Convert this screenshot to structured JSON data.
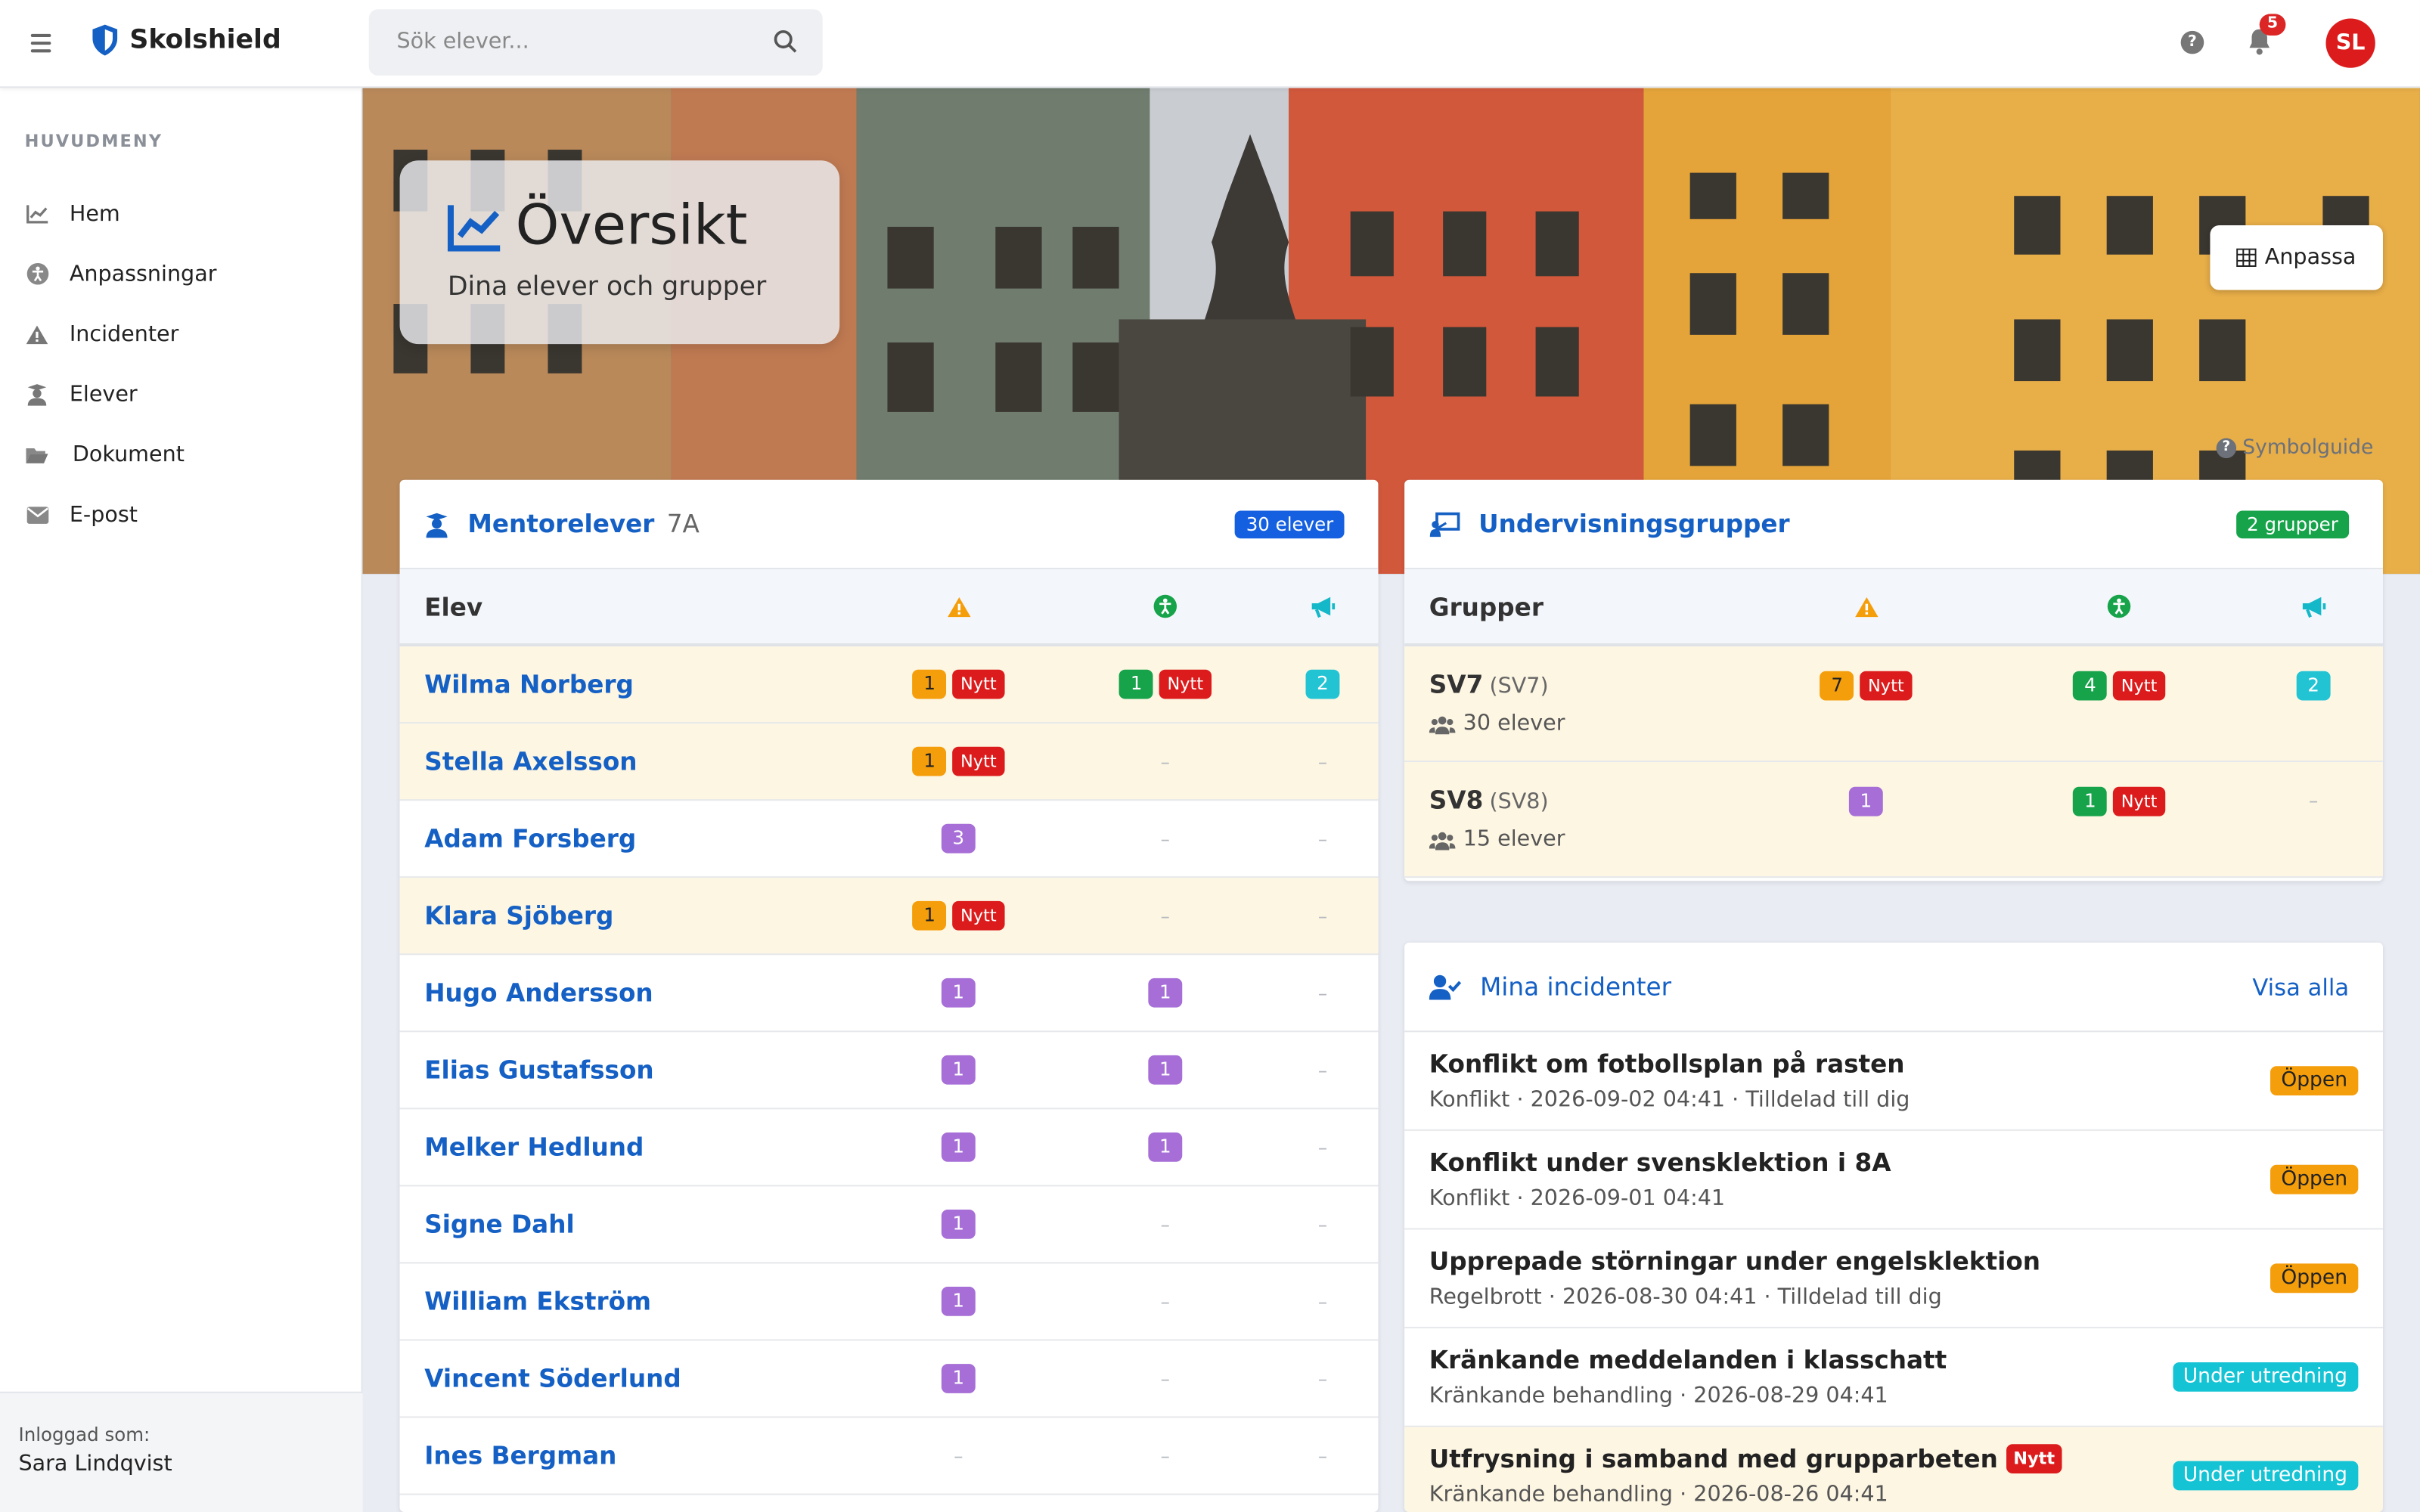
{
  "topbar": {
    "brand": "Skolshield",
    "search_placeholder": "Sök elever...",
    "help": "?",
    "notifications_count": "5",
    "avatar_initials": "SL"
  },
  "sidebar": {
    "heading": "HUVUDMENY",
    "items": [
      {
        "label": "Hem",
        "icon": "chart-line-icon"
      },
      {
        "label": "Anpassningar",
        "icon": "accessibility-icon"
      },
      {
        "label": "Incidenter",
        "icon": "warning-icon"
      },
      {
        "label": "Elever",
        "icon": "student-icon"
      },
      {
        "label": "Dokument",
        "icon": "folder-icon"
      },
      {
        "label": "E-post",
        "icon": "envelope-icon"
      }
    ],
    "logged_in_label": "Inloggad som:",
    "logged_in_user": "Sara Lindqvist"
  },
  "hero": {
    "title": "Översikt",
    "subtitle": "Dina elever och grupper",
    "customize_label": "Anpassa",
    "symbol_guide": "Symbolguide"
  },
  "mentor": {
    "title": "Mentorelever",
    "class": "7A",
    "badge": "30 elever",
    "col_student": "Elev",
    "rows": [
      {
        "name": "Wilma Norberg",
        "inc": "1",
        "inc_new": "Nytt",
        "adj": "1",
        "adj_new": "Nytt",
        "msg": "2",
        "hl": true
      },
      {
        "name": "Stella Axelsson",
        "inc": "1",
        "inc_new": "Nytt",
        "adj": "–",
        "msg": "–",
        "hl": true
      },
      {
        "name": "Adam Forsberg",
        "inc": "3",
        "adj": "–",
        "msg": "–",
        "hl": false
      },
      {
        "name": "Klara Sjöberg",
        "inc": "1",
        "inc_new": "Nytt",
        "adj": "–",
        "msg": "–",
        "hl": true
      },
      {
        "name": "Hugo Andersson",
        "inc": "1",
        "adj": "1",
        "msg": "–",
        "hl": false
      },
      {
        "name": "Elias Gustafsson",
        "inc": "1",
        "adj": "1",
        "msg": "–",
        "hl": false
      },
      {
        "name": "Melker Hedlund",
        "inc": "1",
        "adj": "1",
        "msg": "–",
        "hl": false
      },
      {
        "name": "Signe Dahl",
        "inc": "1",
        "adj": "–",
        "msg": "–",
        "hl": false
      },
      {
        "name": "William Ekström",
        "inc": "1",
        "adj": "–",
        "msg": "–",
        "hl": false
      },
      {
        "name": "Vincent Söderlund",
        "inc": "1",
        "adj": "–",
        "msg": "–",
        "hl": false
      },
      {
        "name": "Ines Bergman",
        "inc": "–",
        "adj": "–",
        "msg": "–",
        "hl": false
      }
    ]
  },
  "groups": {
    "title": "Undervisningsgrupper",
    "badge": "2 grupper",
    "col_groups": "Grupper",
    "rows": [
      {
        "name": "SV7",
        "code": "(SV7)",
        "count": "30 elever",
        "inc": "7",
        "inc_new": "Nytt",
        "adj": "4",
        "adj_new": "Nytt",
        "msg": "2"
      },
      {
        "name": "SV8",
        "code": "(SV8)",
        "count": "15 elever",
        "inc": "1",
        "adj": "1",
        "adj_new": "Nytt",
        "msg": "–"
      }
    ]
  },
  "incidents": {
    "title": "Mina incidenter",
    "view_all": "Visa alla",
    "rows": [
      {
        "title": "Konflikt om fotbollsplan på rasten",
        "meta": "Konflikt · 2026-09-02 04:41 · Tilldelad till dig",
        "status": "Öppen",
        "type": "open"
      },
      {
        "title": "Konflikt under svensklektion i 8A",
        "meta": "Konflikt · 2026-09-01 04:41",
        "status": "Öppen",
        "type": "open"
      },
      {
        "title": "Upprepade störningar under engelsklektion",
        "meta": "Regelbrott · 2026-08-30 04:41 · Tilldelad till dig",
        "status": "Öppen",
        "type": "open"
      },
      {
        "title": "Kränkande meddelanden i klasschatt",
        "meta": "Kränkande behandling · 2026-08-29 04:41",
        "status": "Under utredning",
        "type": "inv"
      },
      {
        "title": "Utfrysning i samband med grupparbeten",
        "new": "Nytt",
        "meta": "Kränkande behandling · 2026-08-26 04:41",
        "status": "Under utredning",
        "type": "inv",
        "hl": true
      }
    ]
  },
  "colors": {
    "brand": "#1560c4",
    "warning": "#f59e0b",
    "success": "#16a34a",
    "danger": "#dc1c1c",
    "info": "#22c4d4",
    "purple": "#a66ed6"
  }
}
